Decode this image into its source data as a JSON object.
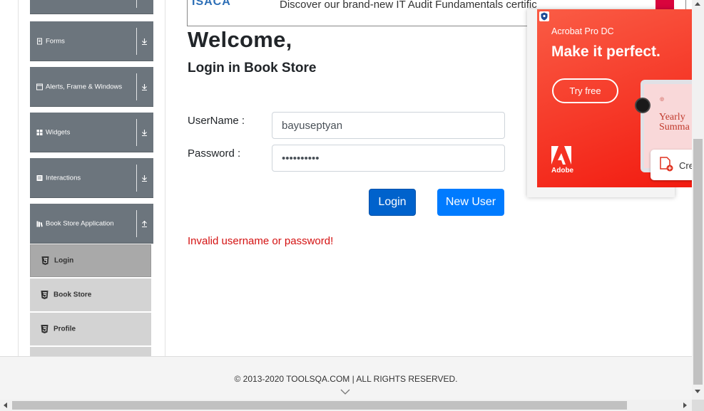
{
  "sidebar": {
    "groups": [
      {
        "label": "",
        "icon": "chevron-down-icon"
      },
      {
        "label": "Forms",
        "icon": "form-icon"
      },
      {
        "label": "Alerts, Frame & Windows",
        "icon": "window-icon"
      },
      {
        "label": "Widgets",
        "icon": "grid-icon"
      },
      {
        "label": "Interactions",
        "icon": "interactions-icon"
      },
      {
        "label": "Book Store Application",
        "icon": "books-icon"
      }
    ],
    "items": [
      {
        "label": "Login",
        "icon": "html5-icon",
        "active": true
      },
      {
        "label": "Book Store",
        "icon": "html5-icon"
      },
      {
        "label": "Profile",
        "icon": "html5-icon"
      }
    ]
  },
  "banner": {
    "text": "Discover our brand-new IT Audit Fundamentals certific"
  },
  "login": {
    "title": "Welcome,",
    "subtitle": "Login in Book Store",
    "username_label": "UserName :",
    "username_value": "bayuseptyan",
    "password_label": "Password :",
    "password_value": "••••••••••",
    "login_button": "Login",
    "new_user_button": "New User",
    "error": "Invalid username or password!"
  },
  "ad": {
    "product": "Acrobat Pro DC",
    "headline": "Make it perfect.",
    "cta": "Try free",
    "screen_text_1": "Yearly",
    "screen_text_2": "Summa",
    "card_text": "Cre",
    "brand": "Adobe",
    "brand_color": "#f21b10"
  },
  "footer": {
    "copyright": "© 2013-2020 TOOLSQA.COM | ALL RIGHTS RESERVED."
  },
  "colors": {
    "primary": "#007bff",
    "error": "#d41111",
    "sidebar_header": "#6c757d"
  }
}
